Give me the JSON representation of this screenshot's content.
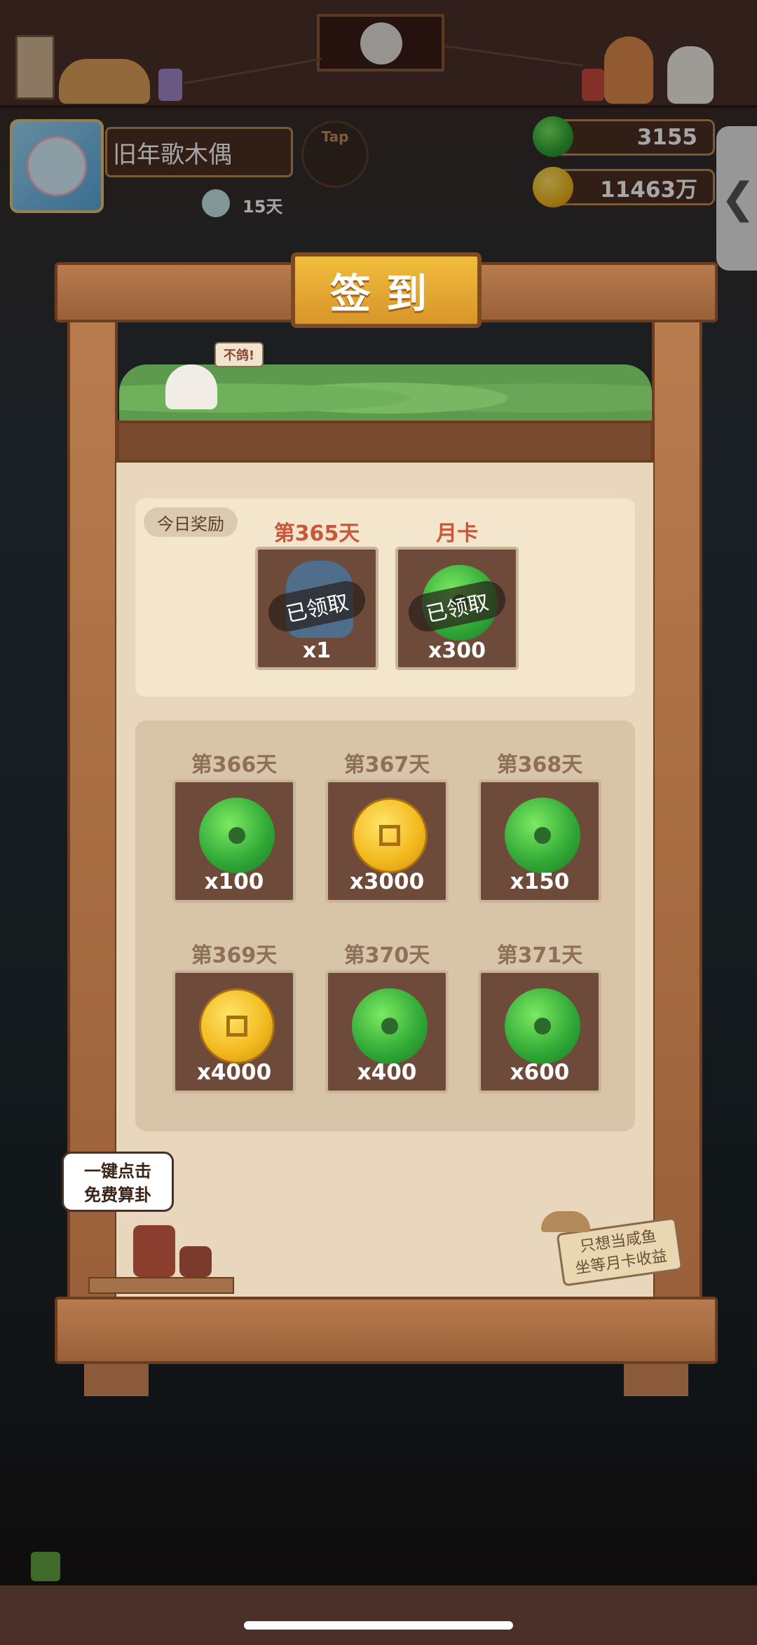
{
  "header": {
    "player_name": "旧年歌木偶",
    "tap_label": "Tap",
    "days": "15天",
    "jade_amount": "3155",
    "coin_amount": "11463万",
    "side_tab_icon": "chevron-left-icon"
  },
  "board": {
    "title": "签到",
    "speech_tag": "不鸽!",
    "today": {
      "label": "今日奖励",
      "rewards": [
        {
          "title": "第365天",
          "status": "已领取",
          "count": "x1",
          "icon": "treasure-bag-icon"
        },
        {
          "title": "月卡",
          "status": "已领取",
          "count": "x300",
          "icon": "jade-icon"
        }
      ]
    },
    "days": [
      {
        "title": "第366天",
        "count": "x100",
        "type": "jade"
      },
      {
        "title": "第367天",
        "count": "x3000",
        "type": "coin"
      },
      {
        "title": "第368天",
        "count": "x150",
        "type": "jade"
      },
      {
        "title": "第369天",
        "count": "x4000",
        "type": "coin"
      },
      {
        "title": "第370天",
        "count": "x400",
        "type": "jade"
      },
      {
        "title": "第371天",
        "count": "x600",
        "type": "jade"
      }
    ],
    "bubble": {
      "line1": "一键点击",
      "line2": "免费算卦"
    },
    "sign": {
      "line1": "只想当咸鱼",
      "line2": "坐等月卡收益"
    }
  },
  "colors": {
    "gold": "#f1bd3c",
    "wood": "#9a6039",
    "jade": "#2fa635",
    "accent_red": "#c8573b"
  }
}
